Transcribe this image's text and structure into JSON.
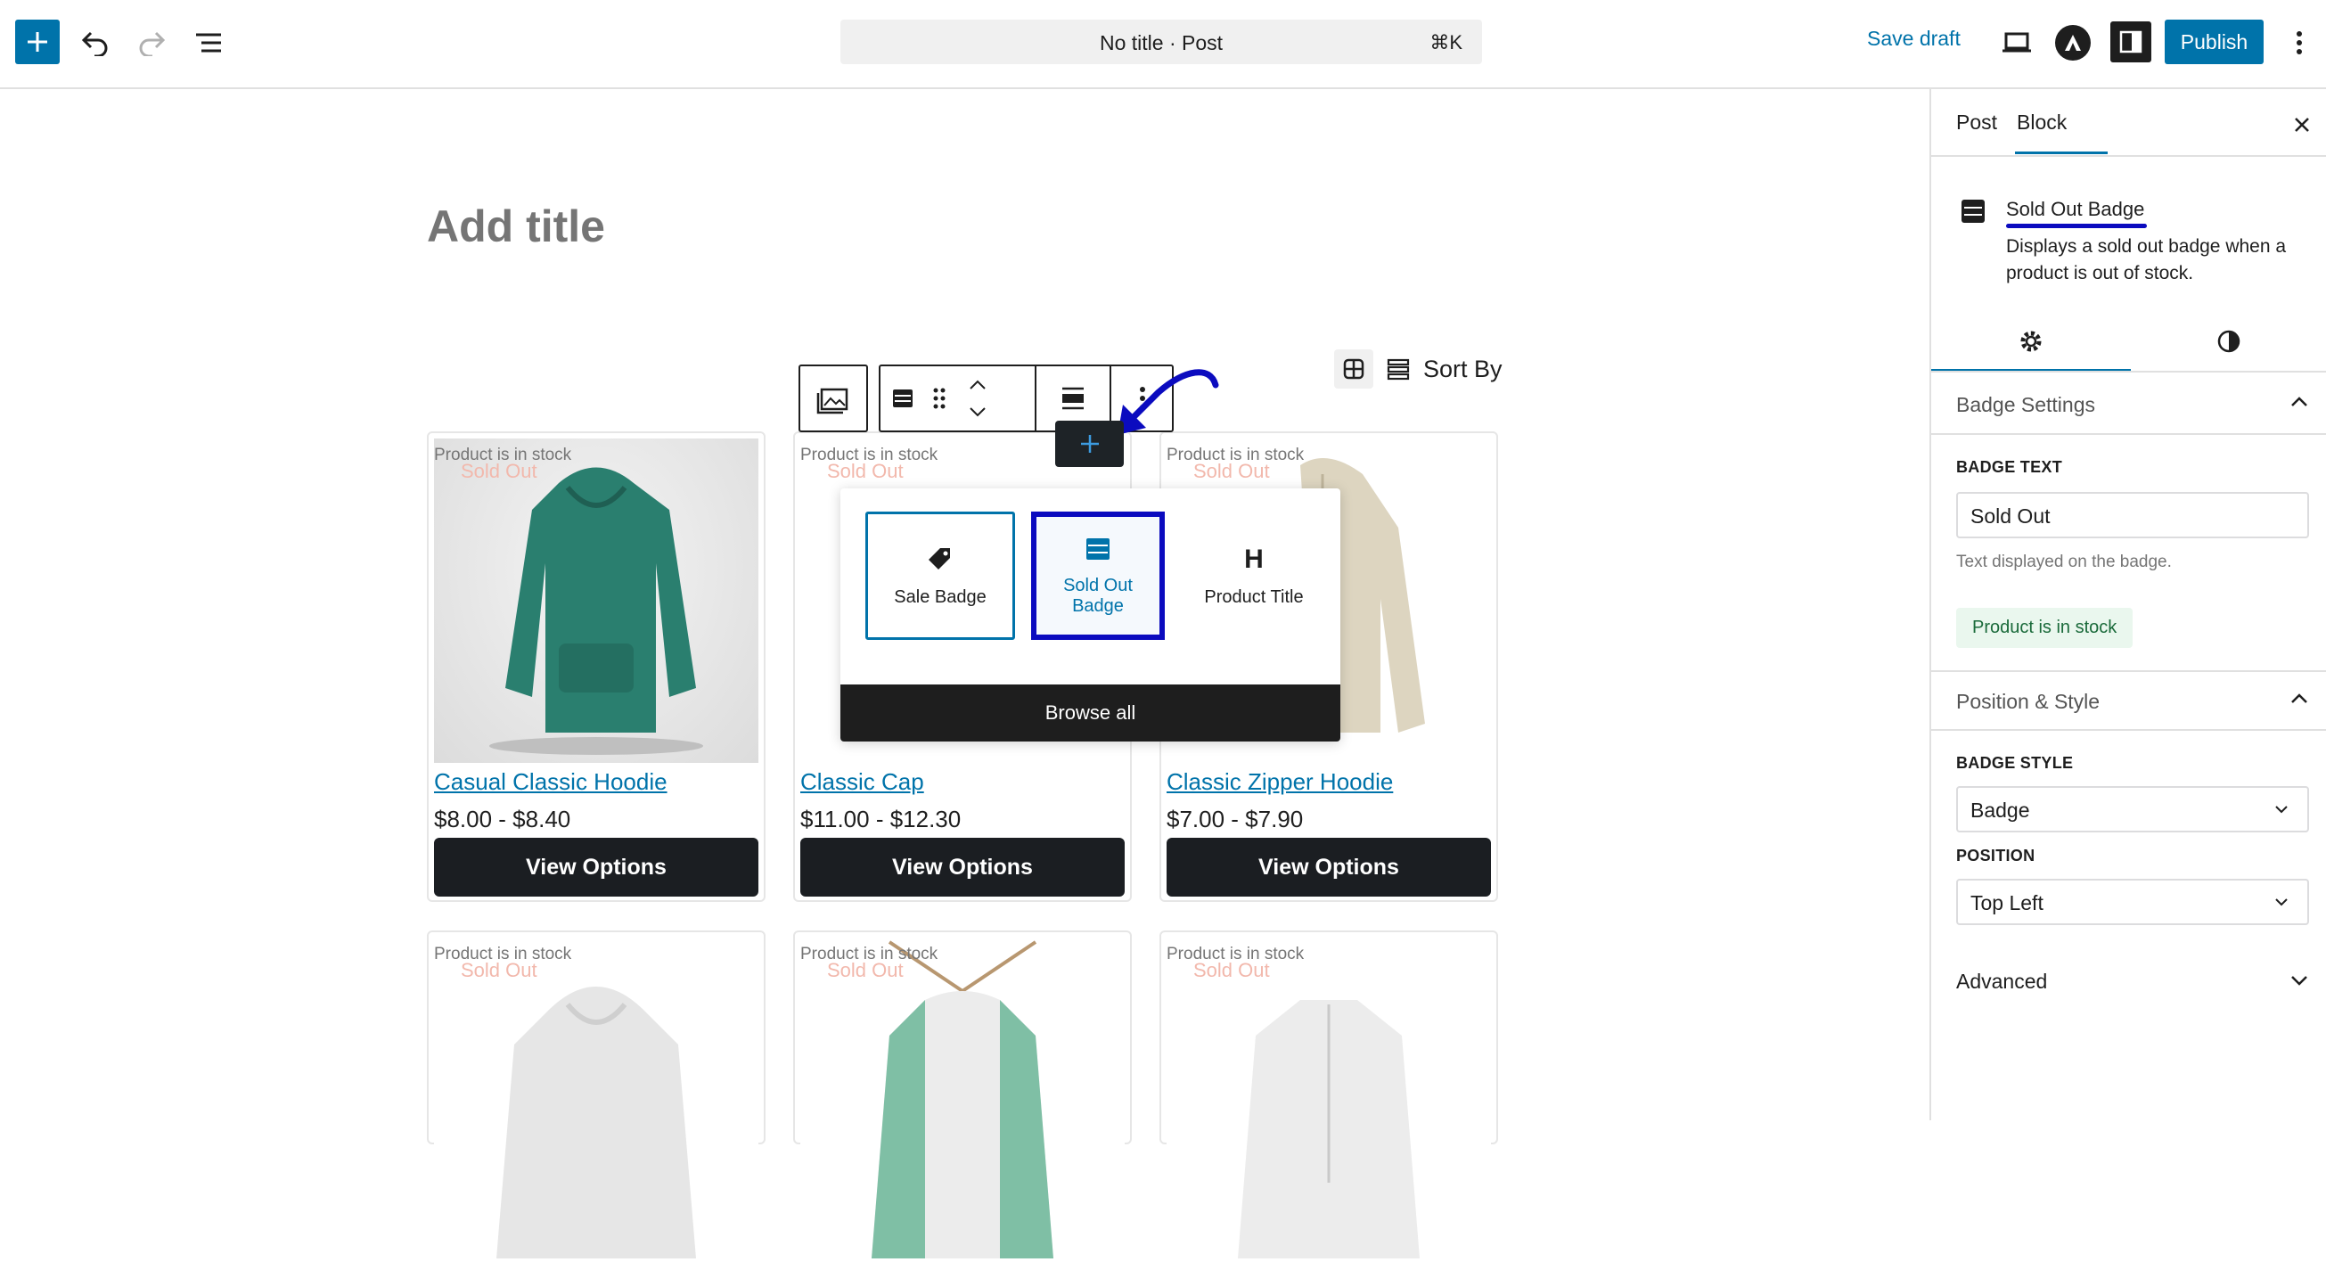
{
  "topbar": {
    "document_title": "No title · Post",
    "shortcut": "⌘K",
    "save_draft": "Save draft",
    "publish": "Publish"
  },
  "editor": {
    "title_placeholder": "Add title",
    "sort_label": "Sort By"
  },
  "products": [
    {
      "title": "Casual Classic Hoodie",
      "price": "$8.00 - $8.40",
      "button": "View Options",
      "stock": "Product is in stock",
      "badge": "Sold Out"
    },
    {
      "title": "Classic Cap",
      "price": "$11.00 - $12.30",
      "button": "View Options",
      "stock": "Product is in stock",
      "badge": "Sold Out"
    },
    {
      "title": "Classic Zipper Hoodie",
      "price": "$7.00 - $7.90",
      "button": "View Options",
      "stock": "Product is in stock",
      "badge": "Sold Out"
    },
    {
      "stock": "Product is in stock",
      "badge": "Sold Out"
    },
    {
      "stock": "Product is in stock",
      "badge": "Sold Out"
    },
    {
      "stock": "Product is in stock",
      "badge": "Sold Out"
    }
  ],
  "inserter": {
    "items": [
      {
        "label": "Sale Badge",
        "icon": "tag-icon"
      },
      {
        "label": "Sold Out Badge",
        "icon": "sold-out-badge-icon"
      },
      {
        "label": "Product Title",
        "icon": "heading-icon",
        "glyph": "H"
      }
    ],
    "browse_all": "Browse all"
  },
  "sidebar": {
    "tabs": [
      "Post",
      "Block"
    ],
    "block_name": "Sold Out Badge",
    "block_description": "Displays a sold out badge when a product is out of stock.",
    "badge_settings": {
      "heading": "Badge Settings",
      "badge_text_label": "BADGE TEXT",
      "badge_text_value": "Sold Out",
      "help": "Text displayed on the badge.",
      "stock_pill": "Product is in stock"
    },
    "position_style": {
      "heading": "Position & Style",
      "badge_style_label": "BADGE STYLE",
      "badge_style_value": "Badge",
      "position_label": "POSITION",
      "position_value": "Top Left"
    },
    "advanced": "Advanced"
  },
  "colors": {
    "accent": "#0073aa",
    "dark": "#1e1e1e",
    "highlight": "#0b0bbf",
    "sold_out_text": "#f2b8ac"
  }
}
